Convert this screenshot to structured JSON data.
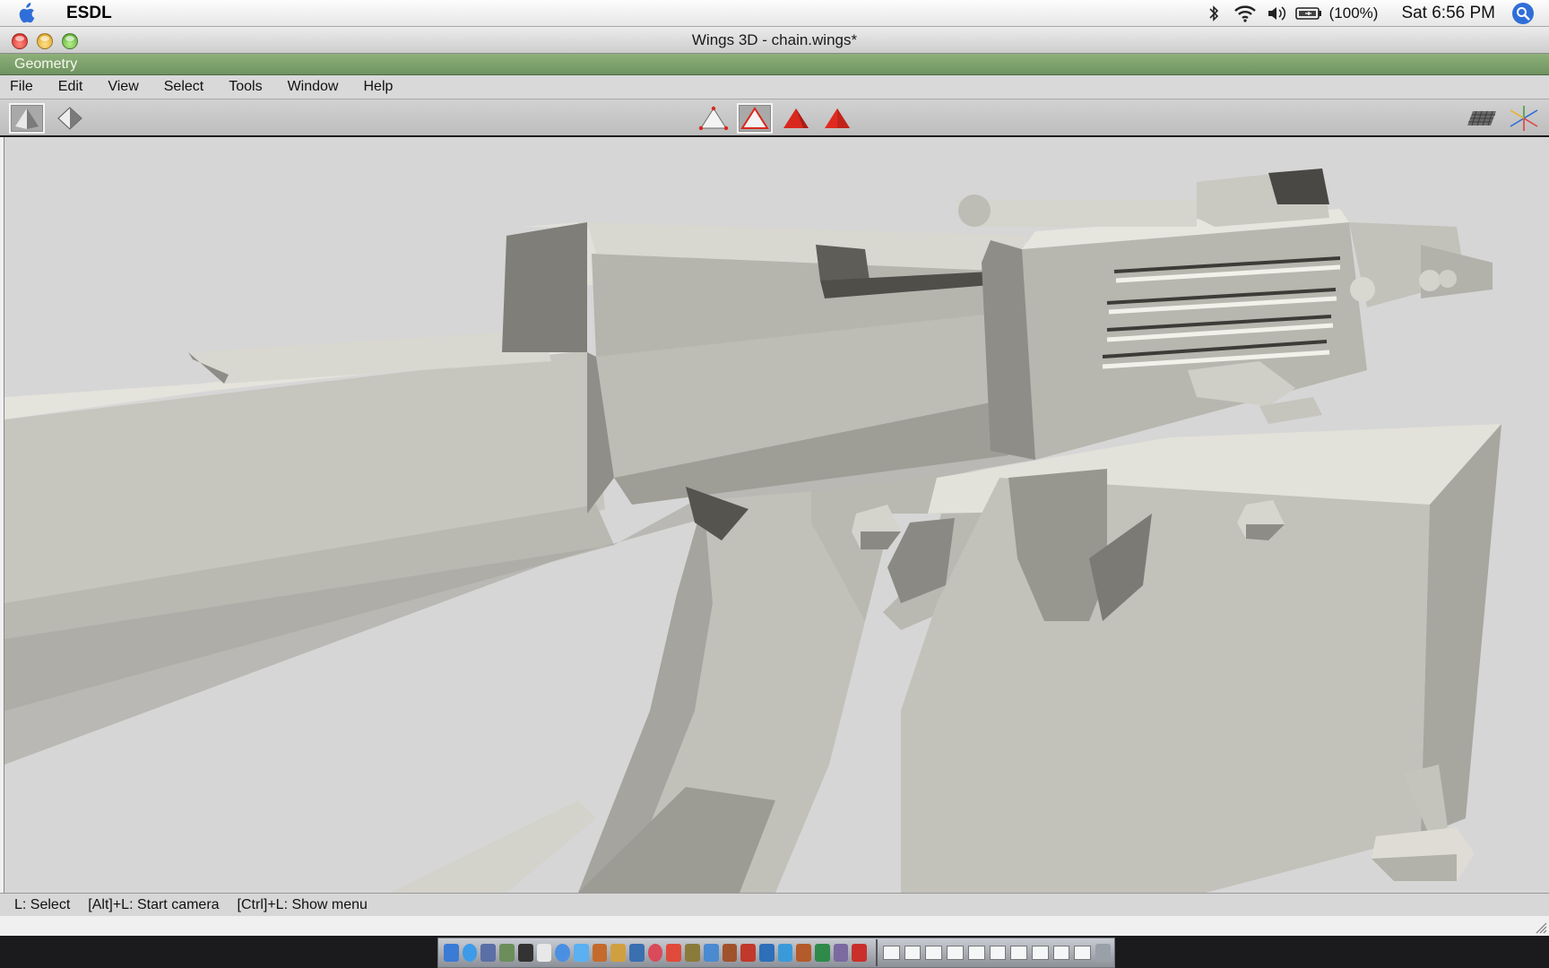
{
  "menubar": {
    "app_name": "ESDL",
    "battery": "(100%)",
    "clock": "Sat 6:56 PM",
    "icons": [
      "apple-icon",
      "bluetooth-icon",
      "wifi-icon",
      "volume-icon",
      "battery-icon",
      "spotlight-icon"
    ]
  },
  "window": {
    "title": "Wings 3D - chain.wings*",
    "geometry_label": "Geometry",
    "menus": [
      "File",
      "Edit",
      "View",
      "Select",
      "Tools",
      "Window",
      "Help"
    ],
    "toolbar": {
      "left_modes": [
        "perspective-view-icon",
        "orthographic-view-icon"
      ],
      "selection_modes": [
        "vertex-select-icon",
        "edge-select-icon",
        "face-select-icon",
        "body-select-icon"
      ],
      "right_tools": [
        "groundplane-icon",
        "axes-icon"
      ]
    },
    "status": [
      "L: Select",
      "[Alt]+L: Start camera",
      "[Ctrl]+L: Show menu"
    ]
  },
  "colors": {
    "geometry_bar": "#7fa36e",
    "viewport_bg": "#d6d6d6",
    "model": "#c9c8c1",
    "selection_red": "#d9281e"
  }
}
